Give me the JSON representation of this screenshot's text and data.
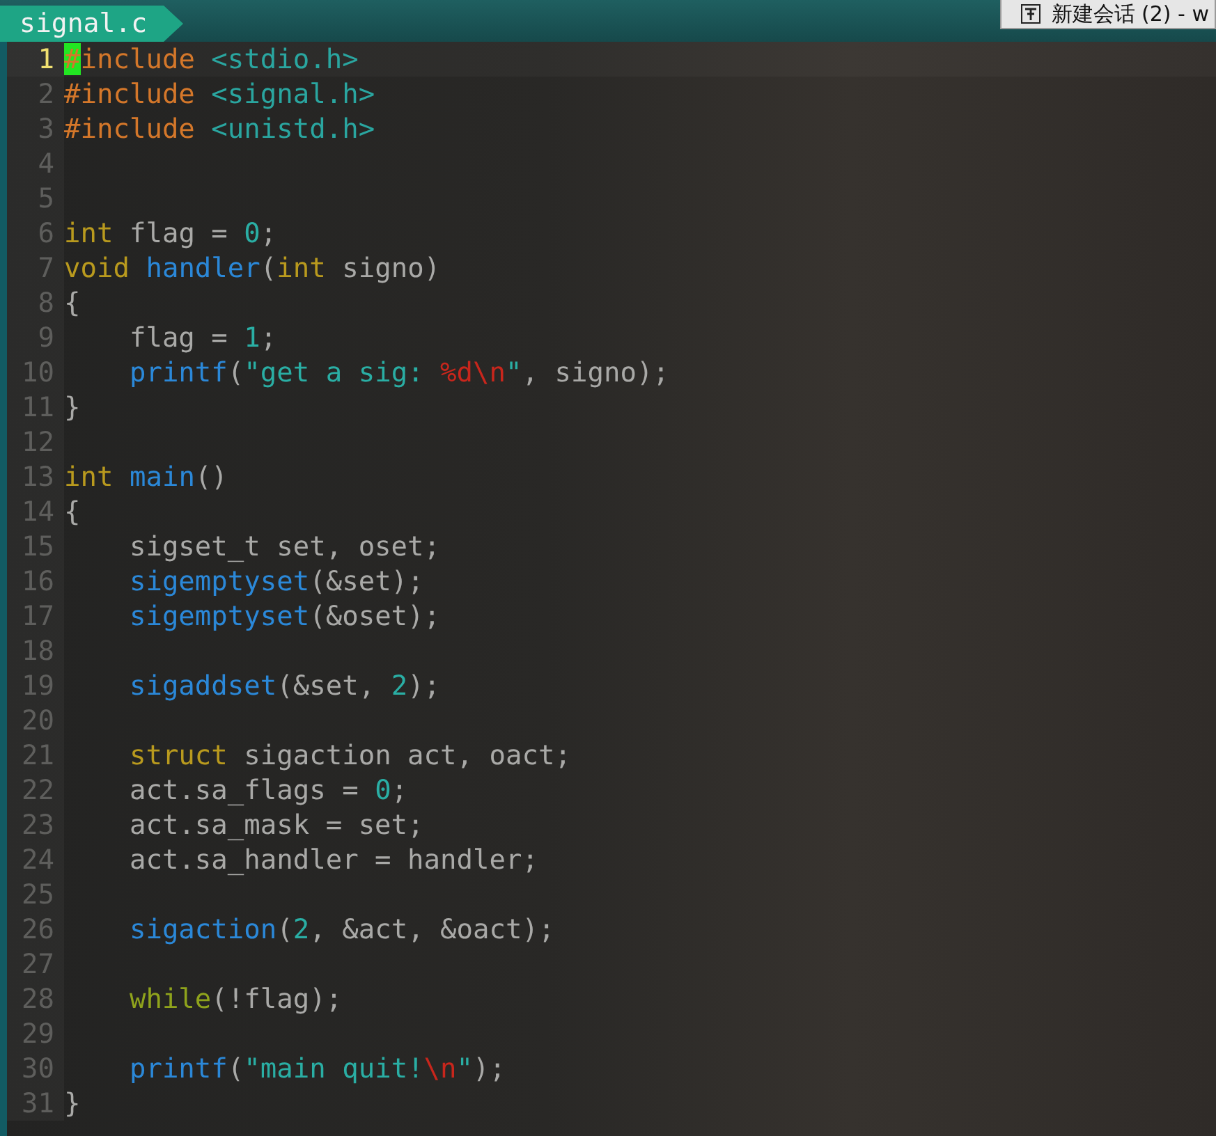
{
  "tab": {
    "label": "signal.c"
  },
  "window_title": {
    "text": "新建会话 (2) - w"
  },
  "lines": [
    {
      "number": "1",
      "current": true,
      "tokens": [
        {
          "kind": "cursor",
          "text": "#"
        },
        {
          "kind": "preproc",
          "text": "include"
        },
        {
          "kind": "path",
          "text": " <stdio.h>"
        }
      ]
    },
    {
      "number": "2",
      "current": false,
      "tokens": [
        {
          "kind": "preproc",
          "text": "#include"
        },
        {
          "kind": "path",
          "text": " <signal.h>"
        }
      ]
    },
    {
      "number": "3",
      "current": false,
      "tokens": [
        {
          "kind": "preproc",
          "text": "#include"
        },
        {
          "kind": "path",
          "text": " <unistd.h>"
        }
      ]
    },
    {
      "number": "4",
      "current": false
    },
    {
      "number": "5",
      "current": false
    },
    {
      "number": "6",
      "current": false,
      "tokens": [
        {
          "kind": "type",
          "text": "int"
        },
        {
          "kind": "plain",
          "text": " flag = "
        },
        {
          "kind": "number",
          "text": "0"
        },
        {
          "kind": "plain",
          "text": ";"
        }
      ]
    },
    {
      "number": "7",
      "current": false,
      "tokens": [
        {
          "kind": "type",
          "text": "void"
        },
        {
          "kind": "func",
          "text": " handler"
        },
        {
          "kind": "plain",
          "text": "("
        },
        {
          "kind": "type",
          "text": "int"
        },
        {
          "kind": "plain",
          "text": " signo)"
        }
      ]
    },
    {
      "number": "8",
      "current": false,
      "tokens": [
        {
          "kind": "plain",
          "text": "{"
        }
      ]
    },
    {
      "number": "9",
      "current": false,
      "tokens": [
        {
          "kind": "plain",
          "text": "    flag = "
        },
        {
          "kind": "number",
          "text": "1"
        },
        {
          "kind": "plain",
          "text": ";"
        }
      ]
    },
    {
      "number": "10",
      "current": false,
      "tokens": [
        {
          "kind": "func",
          "text": "    printf"
        },
        {
          "kind": "plain",
          "text": "("
        },
        {
          "kind": "string",
          "text": "\"get a sig: "
        },
        {
          "kind": "escape",
          "text": "%d\\n"
        },
        {
          "kind": "string",
          "text": "\""
        },
        {
          "kind": "plain",
          "text": ", signo);"
        }
      ]
    },
    {
      "number": "11",
      "current": false,
      "tokens": [
        {
          "kind": "plain",
          "text": "}"
        }
      ]
    },
    {
      "number": "12",
      "current": false
    },
    {
      "number": "13",
      "current": false,
      "tokens": [
        {
          "kind": "type",
          "text": "int"
        },
        {
          "kind": "func",
          "text": " main"
        },
        {
          "kind": "plain",
          "text": "()"
        }
      ]
    },
    {
      "number": "14",
      "current": false,
      "tokens": [
        {
          "kind": "plain",
          "text": "{"
        }
      ]
    },
    {
      "number": "15",
      "current": false,
      "tokens": [
        {
          "kind": "plain",
          "text": "    sigset_t set, oset;"
        }
      ]
    },
    {
      "number": "16",
      "current": false,
      "tokens": [
        {
          "kind": "func",
          "text": "    sigemptyset"
        },
        {
          "kind": "plain",
          "text": "(&set);"
        }
      ]
    },
    {
      "number": "17",
      "current": false,
      "tokens": [
        {
          "kind": "func",
          "text": "    sigemptyset"
        },
        {
          "kind": "plain",
          "text": "(&oset);"
        }
      ]
    },
    {
      "number": "18",
      "current": false
    },
    {
      "number": "19",
      "current": false,
      "tokens": [
        {
          "kind": "func",
          "text": "    sigaddset"
        },
        {
          "kind": "plain",
          "text": "(&set, "
        },
        {
          "kind": "number",
          "text": "2"
        },
        {
          "kind": "plain",
          "text": ");"
        }
      ]
    },
    {
      "number": "20",
      "current": false
    },
    {
      "number": "21",
      "current": false,
      "tokens": [
        {
          "kind": "type",
          "text": "    struct"
        },
        {
          "kind": "plain",
          "text": " sigaction act, oact;"
        }
      ]
    },
    {
      "number": "22",
      "current": false,
      "tokens": [
        {
          "kind": "plain",
          "text": "    act.sa_flags = "
        },
        {
          "kind": "number",
          "text": "0"
        },
        {
          "kind": "plain",
          "text": ";"
        }
      ]
    },
    {
      "number": "23",
      "current": false,
      "tokens": [
        {
          "kind": "plain",
          "text": "    act.sa_mask = set;"
        }
      ]
    },
    {
      "number": "24",
      "current": false,
      "tokens": [
        {
          "kind": "plain",
          "text": "    act.sa_handler = handler;"
        }
      ]
    },
    {
      "number": "25",
      "current": false
    },
    {
      "number": "26",
      "current": false,
      "tokens": [
        {
          "kind": "func",
          "text": "    sigaction"
        },
        {
          "kind": "plain",
          "text": "("
        },
        {
          "kind": "number",
          "text": "2"
        },
        {
          "kind": "plain",
          "text": ", &act, &oact);"
        }
      ]
    },
    {
      "number": "27",
      "current": false
    },
    {
      "number": "28",
      "current": false,
      "tokens": [
        {
          "kind": "keyword",
          "text": "    while"
        },
        {
          "kind": "plain",
          "text": "(!flag);"
        }
      ]
    },
    {
      "number": "29",
      "current": false
    },
    {
      "number": "30",
      "current": false,
      "tokens": [
        {
          "kind": "func",
          "text": "    printf"
        },
        {
          "kind": "plain",
          "text": "("
        },
        {
          "kind": "string",
          "text": "\"main quit!"
        },
        {
          "kind": "escape",
          "text": "\\n"
        },
        {
          "kind": "string",
          "text": "\""
        },
        {
          "kind": "plain",
          "text": ");"
        }
      ]
    },
    {
      "number": "31",
      "current": false,
      "tokens": [
        {
          "kind": "plain",
          "text": "}"
        }
      ]
    }
  ]
}
